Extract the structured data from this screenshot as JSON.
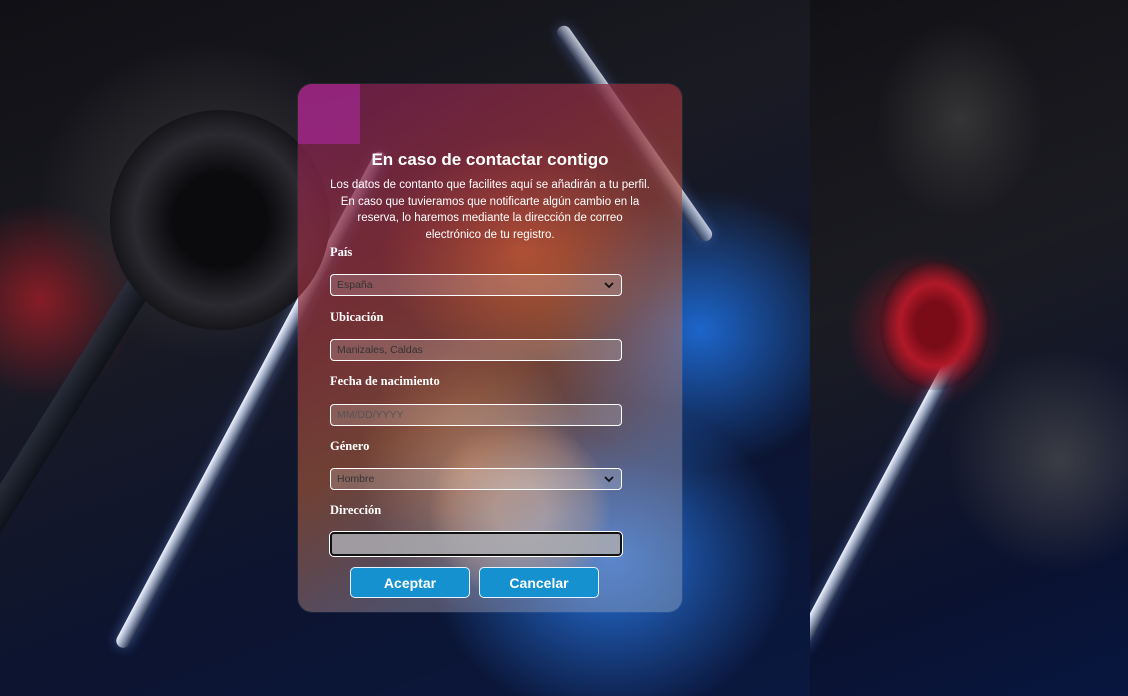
{
  "dialog": {
    "title": "En caso de contactar contigo",
    "description": "Los datos de contanto que facilites aquí se añadirán a tu perfil. En caso que tuvieramos que notificarte algún cambio en la reserva, lo haremos mediante la dirección de correo electrónico de tu registro."
  },
  "form": {
    "pais": {
      "label": "País",
      "value": "España"
    },
    "ubicacion": {
      "label": "Ubicación",
      "value": "Manizales, Caldas"
    },
    "fecha": {
      "label": "Fecha de nacimiento",
      "placeholder": "MM/DD/YYYY"
    },
    "genero": {
      "label": "Género",
      "value": "Hombre"
    },
    "direccion": {
      "label": "Dirección",
      "value": ""
    }
  },
  "buttons": {
    "accept_label": "Aceptar",
    "cancel_label": "Cancelar"
  },
  "icons": {
    "select_arrow": "chevron-down-icon"
  },
  "colors": {
    "button_bg": "#1591d0",
    "dialog_tint_top": "#781e50",
    "dialog_tint_bottom": "#96aac8"
  }
}
